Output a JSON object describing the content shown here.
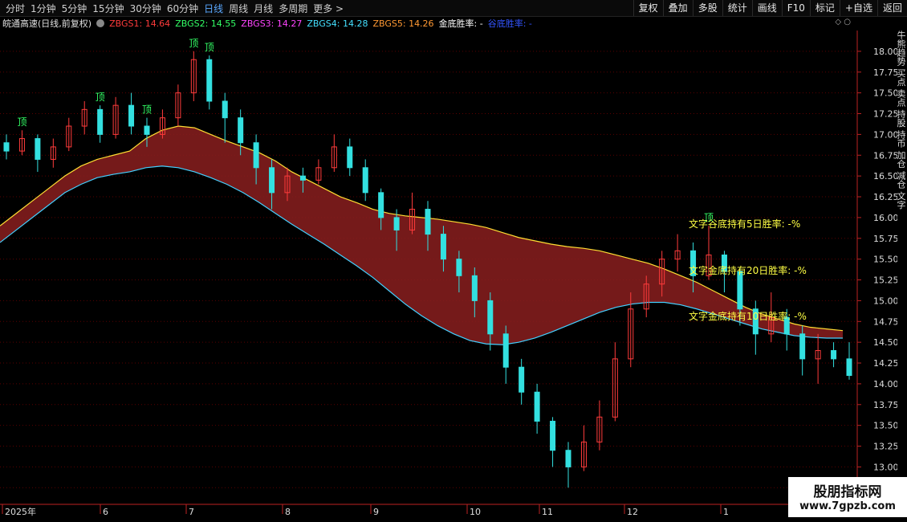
{
  "toolbar": {
    "periods": [
      "分时",
      "1分钟",
      "5分钟",
      "15分钟",
      "30分钟",
      "60分钟",
      "日线",
      "周线",
      "月线",
      "多周期",
      "更多 >"
    ],
    "active_period": "日线",
    "right_buttons": [
      "复权",
      "叠加",
      "多股",
      "统计",
      "画线",
      "F10",
      "标记",
      "+自选",
      "返回"
    ]
  },
  "legend": {
    "stock_title": "皖通高速(日线,前复权)",
    "items": [
      {
        "label": "ZBGS1: 14.64",
        "color": "#ff3b3b"
      },
      {
        "label": "ZBGS2: 14.55",
        "color": "#33ff66"
      },
      {
        "label": "ZBGS3: 14.27",
        "color": "#ff44ff"
      },
      {
        "label": "ZBGS4: 14.28",
        "color": "#44e0ff"
      },
      {
        "label": "ZBGS5: 14.26",
        "color": "#ff9933"
      },
      {
        "label": "金底胜率: -",
        "color": "#ffffff"
      },
      {
        "label": "谷底胜率: -",
        "color": "#3355ff"
      }
    ]
  },
  "chart_data": {
    "type": "candlestick",
    "ylim": [
      12.55,
      18.25
    ],
    "y_ticks": [
      "18.00",
      "17.75",
      "17.50",
      "17.25",
      "17.00",
      "16.75",
      "16.50",
      "16.25",
      "16.00",
      "15.75",
      "15.50",
      "15.25",
      "15.00",
      "14.75",
      "14.50",
      "14.25",
      "14.00",
      "13.75",
      "13.50",
      "13.25",
      "13.00",
      "12.75"
    ],
    "x_labels": [
      "2025年",
      "6",
      "7",
      "8",
      "9",
      "10",
      "11",
      "12",
      "1"
    ],
    "annotations": [
      {
        "text": "文字谷底持有5日胜率: -%",
        "color": "#ffff44"
      },
      {
        "text": "文字金底持有20日胜率: -%",
        "color": "#ffff44"
      },
      {
        "text": "文字金底持有10日胜率: -%",
        "color": "#ffff44"
      }
    ],
    "top_marks": [
      "顶",
      "顶",
      "顶",
      "顶",
      "顶",
      "顶"
    ],
    "side_text": "牛熊趋势 买点 卖点 持股 持币 加仓 减仓 文字",
    "series": [
      {
        "name": "ZBGS1",
        "values": [
          15.9,
          16.05,
          16.2,
          16.35,
          16.5,
          16.62,
          16.7,
          16.75,
          16.8,
          16.95,
          17.05,
          17.1,
          17.08,
          17.0,
          16.92,
          16.85,
          16.78,
          16.68,
          16.55,
          16.45,
          16.35,
          16.25,
          16.18,
          16.1,
          16.05,
          16.02,
          16.0,
          15.98,
          15.95,
          15.92,
          15.88,
          15.82,
          15.76,
          15.72,
          15.68,
          15.65,
          15.63,
          15.6,
          15.55,
          15.5,
          15.45,
          15.38,
          15.3,
          15.22,
          15.12,
          15.02,
          14.92,
          14.84,
          14.78,
          14.72,
          14.68,
          14.66,
          14.64
        ]
      },
      {
        "name": "ZBGS2",
        "values": [
          15.7,
          15.85,
          16.0,
          16.15,
          16.3,
          16.4,
          16.48,
          16.52,
          16.55,
          16.6,
          16.62,
          16.6,
          16.55,
          16.48,
          16.4,
          16.3,
          16.18,
          16.05,
          15.92,
          15.8,
          15.68,
          15.55,
          15.42,
          15.28,
          15.12,
          14.96,
          14.82,
          14.7,
          14.6,
          14.52,
          14.48,
          14.47,
          14.5,
          14.55,
          14.62,
          14.7,
          14.78,
          14.86,
          14.92,
          14.96,
          14.98,
          14.98,
          14.95,
          14.9,
          14.84,
          14.78,
          14.72,
          14.66,
          14.62,
          14.58,
          14.56,
          14.55,
          14.55
        ]
      }
    ],
    "candles": [
      [
        16.9,
        16.8,
        17.0,
        16.7
      ],
      [
        16.8,
        16.95,
        17.05,
        16.75
      ],
      [
        16.95,
        16.7,
        17.0,
        16.55
      ],
      [
        16.7,
        16.85,
        16.95,
        16.6
      ],
      [
        16.85,
        17.1,
        17.2,
        16.8
      ],
      [
        17.1,
        17.3,
        17.4,
        17.0
      ],
      [
        17.3,
        17.0,
        17.35,
        16.9
      ],
      [
        17.0,
        17.35,
        17.45,
        16.95
      ],
      [
        17.35,
        17.1,
        17.5,
        17.0
      ],
      [
        17.1,
        17.0,
        17.2,
        16.85
      ],
      [
        17.0,
        17.2,
        17.3,
        16.95
      ],
      [
        17.2,
        17.5,
        17.6,
        17.1
      ],
      [
        17.5,
        17.9,
        18.0,
        17.4
      ],
      [
        17.9,
        17.4,
        17.95,
        17.3
      ],
      [
        17.4,
        17.2,
        17.5,
        16.9
      ],
      [
        17.2,
        16.9,
        17.3,
        16.75
      ],
      [
        16.9,
        16.6,
        17.0,
        16.4
      ],
      [
        16.6,
        16.3,
        16.7,
        16.1
      ],
      [
        16.3,
        16.5,
        16.6,
        16.2
      ],
      [
        16.5,
        16.45,
        16.6,
        16.3
      ],
      [
        16.45,
        16.6,
        16.7,
        16.4
      ],
      [
        16.6,
        16.85,
        17.0,
        16.55
      ],
      [
        16.85,
        16.6,
        16.95,
        16.5
      ],
      [
        16.6,
        16.3,
        16.7,
        16.2
      ],
      [
        16.3,
        16.0,
        16.35,
        15.85
      ],
      [
        16.0,
        15.85,
        16.1,
        15.6
      ],
      [
        15.85,
        16.1,
        16.3,
        15.8
      ],
      [
        16.1,
        15.8,
        16.2,
        15.6
      ],
      [
        15.8,
        15.5,
        15.9,
        15.35
      ],
      [
        15.5,
        15.3,
        15.6,
        15.1
      ],
      [
        15.3,
        15.0,
        15.4,
        14.8
      ],
      [
        15.0,
        14.6,
        15.1,
        14.4
      ],
      [
        14.6,
        14.2,
        14.7,
        14.0
      ],
      [
        14.2,
        13.9,
        14.3,
        13.75
      ],
      [
        13.9,
        13.55,
        14.0,
        13.4
      ],
      [
        13.55,
        13.2,
        13.6,
        13.0
      ],
      [
        13.2,
        13.0,
        13.3,
        12.75
      ],
      [
        13.0,
        13.3,
        13.5,
        12.95
      ],
      [
        13.3,
        13.6,
        13.8,
        13.2
      ],
      [
        13.6,
        14.3,
        14.5,
        13.55
      ],
      [
        14.3,
        14.9,
        15.1,
        14.2
      ],
      [
        14.9,
        15.2,
        15.3,
        14.8
      ],
      [
        15.2,
        15.5,
        15.6,
        15.05
      ],
      [
        15.5,
        15.6,
        15.8,
        15.35
      ],
      [
        15.6,
        15.3,
        15.7,
        15.1
      ],
      [
        15.3,
        15.55,
        15.9,
        15.25
      ],
      [
        15.55,
        15.35,
        15.6,
        15.1
      ],
      [
        15.35,
        14.9,
        15.4,
        14.7
      ],
      [
        14.9,
        14.6,
        15.0,
        14.35
      ],
      [
        14.6,
        14.8,
        15.1,
        14.5
      ],
      [
        14.8,
        14.6,
        14.9,
        14.4
      ],
      [
        14.6,
        14.3,
        14.7,
        14.1
      ],
      [
        14.3,
        14.4,
        14.6,
        14.0
      ],
      [
        14.4,
        14.3,
        14.5,
        14.2
      ],
      [
        14.3,
        14.1,
        14.5,
        14.05
      ]
    ]
  },
  "watermark": {
    "title": "股朋指标网",
    "url": "www.7gpzb.com"
  }
}
